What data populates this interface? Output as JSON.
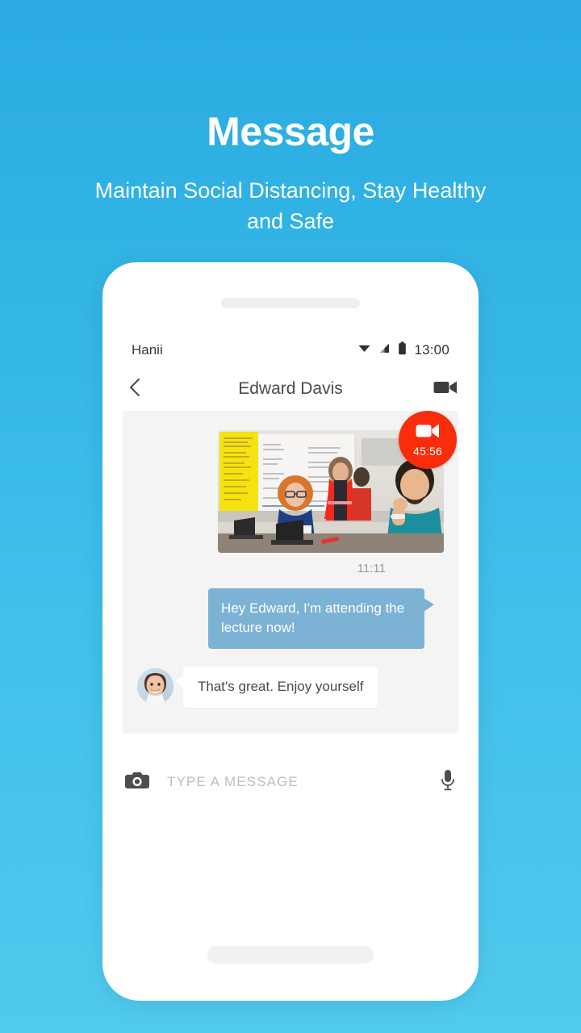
{
  "promo": {
    "title": "Message",
    "subtitle": "Maintain Social Distancing, Stay Healthy and Safe"
  },
  "colors": {
    "background_top": "#2aaae1",
    "background_bottom": "#50cbef",
    "outgoing_bubble": "#7cb2d4",
    "call_badge": "#f92c0c",
    "chat_background": "#f4f4f4",
    "phone_body": "#ffffff"
  },
  "phone": {
    "statusbar": {
      "carrier": "Hanii",
      "time": "13:00",
      "icons": [
        "wifi-icon",
        "cellular-signal-icon",
        "battery-icon"
      ]
    },
    "appbar": {
      "back_icon": "chevron-left-icon",
      "title": "Edward Davis",
      "video_call_icon": "video-camera-icon"
    },
    "speaker_grille": "speaker-grille",
    "home_indicator": "home-indicator"
  },
  "chat": {
    "messages": [
      {
        "kind": "media",
        "media_alt": "classroom-workshop-photo",
        "call_badge": {
          "icon": "video-camera-icon",
          "duration": "45:56"
        },
        "time": "11:11"
      },
      {
        "kind": "outgoing",
        "text": "Hey Edward, I'm attending the lecture now!"
      },
      {
        "kind": "incoming",
        "avatar_alt": "contact-avatar-photo",
        "text": "That's great. Enjoy yourself"
      }
    ]
  },
  "composer": {
    "camera_icon": "camera-icon",
    "placeholder": "TYPE A MESSAGE",
    "value": "",
    "mic_icon": "microphone-icon"
  }
}
